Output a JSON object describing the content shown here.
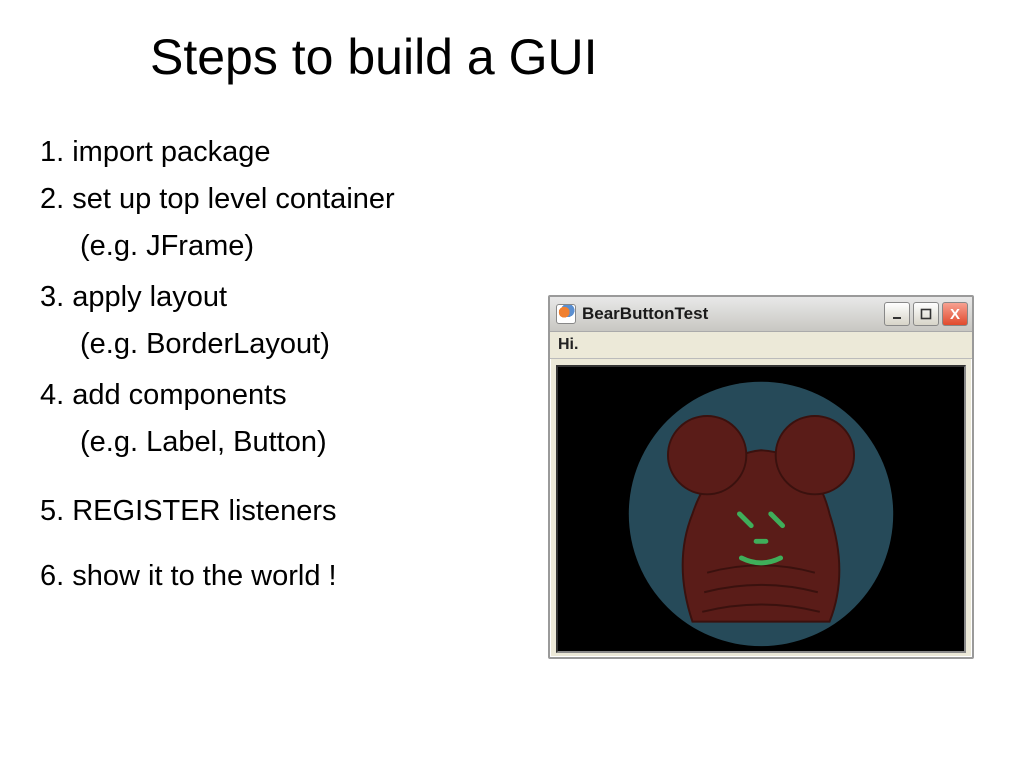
{
  "title": "Steps to build a GUI",
  "steps": [
    {
      "text": "1. import package"
    },
    {
      "text": "2. set up top level container",
      "sub": "(e.g. JFrame)"
    },
    {
      "text": "3. apply layout",
      "sub": "(e.g. BorderLayout)"
    },
    {
      "text": "4. add components",
      "sub": "(e.g. Label, Button)"
    },
    {
      "text": "5. REGISTER listeners"
    },
    {
      "text": "6. show it to the world !"
    }
  ],
  "window": {
    "title": "BearButtonTest",
    "label": "Hi.",
    "buttons": {
      "min": "_",
      "max": "□",
      "close": "X"
    }
  }
}
